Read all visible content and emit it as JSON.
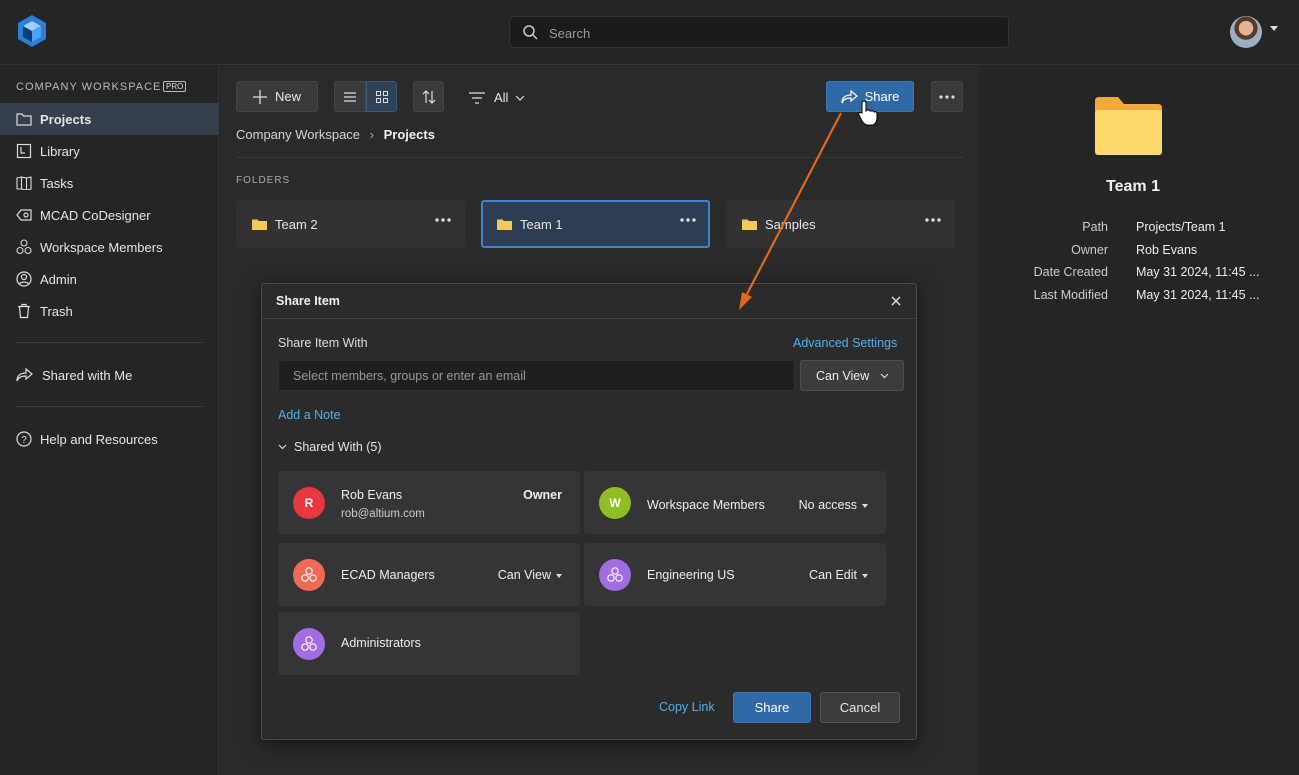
{
  "search": {
    "placeholder": "Search"
  },
  "sidebar": {
    "workspace_label": "COMPANY WORKSPACE",
    "badge": "PRO",
    "items": [
      {
        "label": "Projects",
        "icon": "folder-icon",
        "active": true
      },
      {
        "label": "Library",
        "icon": "library-icon"
      },
      {
        "label": "Tasks",
        "icon": "tasks-icon"
      },
      {
        "label": "MCAD CoDesigner",
        "icon": "mcad-icon"
      },
      {
        "label": "Workspace Members",
        "icon": "members-icon"
      },
      {
        "label": "Admin",
        "icon": "admin-icon"
      },
      {
        "label": "Trash",
        "icon": "trash-icon"
      }
    ],
    "shared_with_me": "Shared with Me",
    "help": "Help and Resources"
  },
  "toolbar": {
    "new_label": "New",
    "filter_label": "All",
    "share_label": "Share"
  },
  "breadcrumb": {
    "root": "Company Workspace",
    "current": "Projects"
  },
  "folders": {
    "section_label": "FOLDERS",
    "items": [
      {
        "name": "Team 2"
      },
      {
        "name": "Team 1",
        "selected": true
      },
      {
        "name": "Samples"
      }
    ]
  },
  "details": {
    "title": "Team 1",
    "rows": [
      {
        "key": "Path",
        "value": "Projects/Team 1"
      },
      {
        "key": "Owner",
        "value": "Rob Evans"
      },
      {
        "key": "Date Created",
        "value": "May 31 2024, 11:45 ..."
      },
      {
        "key": "Last Modified",
        "value": "May 31 2024, 11:45 ..."
      }
    ]
  },
  "dialog": {
    "title": "Share Item",
    "share_with_label": "Share Item With",
    "advanced_settings": "Advanced Settings",
    "input_placeholder": "Select members, groups or enter an email",
    "permission": "Can View",
    "add_note": "Add a Note",
    "shared_with": "Shared With (5)",
    "members": [
      {
        "name": "Rob Evans",
        "email": "rob@altium.com",
        "role": "Owner",
        "initial": "R",
        "color": "#e8373f"
      },
      {
        "name": "Workspace Members",
        "role": "No access",
        "initial": "W",
        "color": "#8dbe24"
      },
      {
        "name": "ECAD Managers",
        "role": "Can View",
        "color": "#ee6a57"
      },
      {
        "name": "Engineering US",
        "role": "Can Edit",
        "color": "#a26de0"
      },
      {
        "name": "Administrators",
        "role": "",
        "color": "#a26de0"
      }
    ],
    "copy_link": "Copy Link",
    "share_button": "Share",
    "cancel_button": "Cancel"
  },
  "colors": {
    "accent": "#2f6aa6",
    "link": "#4fb0ef",
    "annotation_arrow": "#e06a1c",
    "folder": "#f5c85a"
  }
}
